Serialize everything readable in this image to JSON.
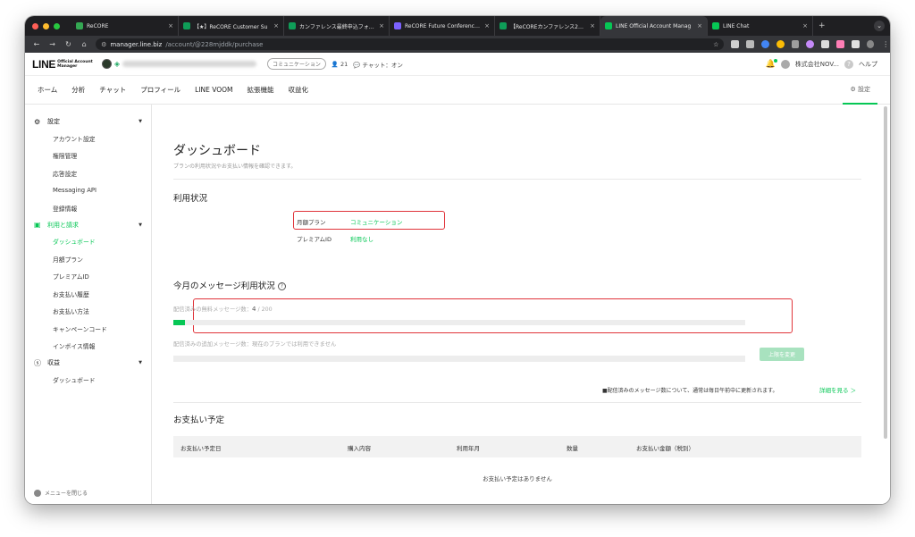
{
  "browser": {
    "tabs": [
      {
        "title": "ReCORE",
        "color": "#34a853"
      },
      {
        "title": "【★】ReCORE Customer Su",
        "color": "#0f9d58"
      },
      {
        "title": "カンファレンス最終申込フォーム",
        "color": "#0f9d58"
      },
      {
        "title": "ReCORE Future Conference 2",
        "color": "#7b61ff"
      },
      {
        "title": "【ReCOREカンファレンス2024",
        "color": "#0f9d58"
      },
      {
        "title": "LINE Official Account Manag",
        "color": "#06c755"
      },
      {
        "title": "LINE Chat",
        "color": "#06c755"
      }
    ],
    "url_host": "manager.line.biz",
    "url_path": "/account/@228mjddk/purchase"
  },
  "header": {
    "logo_main": "LINE",
    "logo_sub1": "Official Account",
    "logo_sub2": "Manager",
    "plan_pill": "コミュニケーション",
    "friends": "21",
    "chat_status": "チャット：オン",
    "company": "株式会社NOV...",
    "help": "ヘルプ"
  },
  "nav": {
    "items": [
      "ホーム",
      "分析",
      "チャット",
      "プロフィール",
      "LINE VOOM",
      "拡張機能",
      "収益化"
    ],
    "settings": "設定"
  },
  "sidebar": {
    "settings_label": "設定",
    "settings_items": [
      "アカウント設定",
      "権限管理",
      "応答設定",
      "Messaging API",
      "登録情報"
    ],
    "billing_label": "利用と請求",
    "billing_items": [
      "ダッシュボード",
      "月額プラン",
      "プレミアムID",
      "お支払い履歴",
      "お支払い方法",
      "キャンペーンコード",
      "インボイス情報"
    ],
    "revenue_label": "収益",
    "revenue_items": [
      "ダッシュボード"
    ],
    "close_menu": "メニューを閉じる"
  },
  "content": {
    "title": "ダッシュボード",
    "subtitle": "プランの利用状況やお支払い情報を確認できます。",
    "usage_title": "利用状況",
    "plan_label": "月額プラン",
    "plan_value": "コミュニケーション",
    "premium_label": "プレミアムID",
    "premium_value": "利用なし",
    "messages_title": "今月のメッセージ利用状況",
    "free_label": "配信済みの無料メッセージ数：",
    "free_used": "4",
    "free_total": "/ 200",
    "free_ratio": 0.02,
    "extra_label": "配信済みの追加メッセージ数：",
    "extra_value": "現在のプランでは利用できません",
    "upgrade_button": "上限を変更",
    "note": "■配信済みのメッセージ数について、通常は毎日午前中に更新されます。",
    "details_link": "詳細を見る ＞",
    "payments_title": "お支払い予定",
    "table_headers": [
      "お支払い予定日",
      "購入内容",
      "利用年月",
      "数量",
      "お支払い金額（税別）"
    ],
    "empty_text": "お支払い予定はありません"
  }
}
